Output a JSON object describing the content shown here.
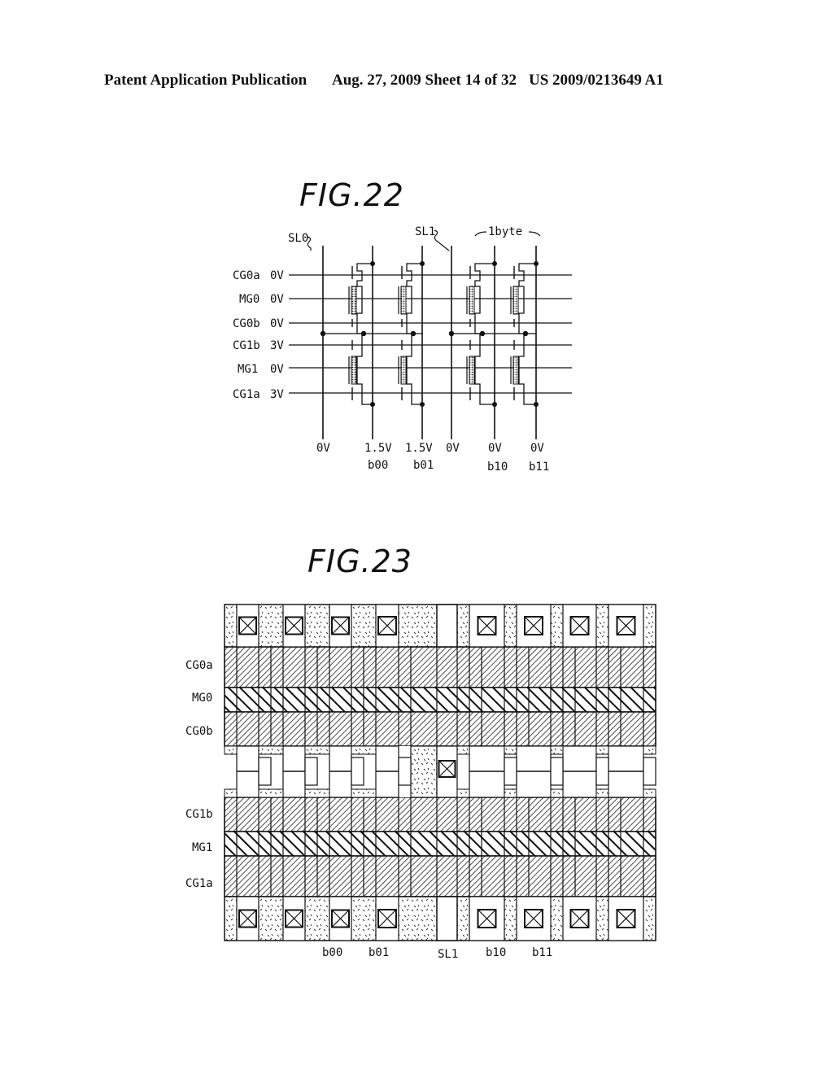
{
  "header": {
    "publication": "Patent Application Publication",
    "date_sheet": "Aug. 27, 2009  Sheet 14 of 32",
    "patent_number": "US 2009/0213649 A1"
  },
  "fig22": {
    "title": "FIG.22",
    "source_line_labels": [
      "SL0",
      "SL1"
    ],
    "group_label": "1byte",
    "rows": [
      {
        "name": "CG0a",
        "voltage": "0V"
      },
      {
        "name": "MG0",
        "voltage": "0V"
      },
      {
        "name": "CG0b",
        "voltage": "0V"
      },
      {
        "name": "CG1b",
        "voltage": "3V"
      },
      {
        "name": "MG1",
        "voltage": "0V"
      },
      {
        "name": "CG1a",
        "voltage": "3V"
      }
    ],
    "columns": [
      {
        "voltage": "0V",
        "bit": ""
      },
      {
        "voltage": "1.5V",
        "bit": "b00"
      },
      {
        "voltage": "1.5V",
        "bit": "b01"
      },
      {
        "voltage": "0V",
        "bit": ""
      },
      {
        "voltage": "0V",
        "bit": "b10"
      },
      {
        "voltage": "0V",
        "bit": "b11"
      }
    ]
  },
  "fig23": {
    "title": "FIG.23",
    "row_labels": [
      "CG0a",
      "MG0",
      "CG0b",
      "CG1b",
      "MG1",
      "CG1a"
    ],
    "bottom_labels": [
      "b00",
      "b01",
      "SL1",
      "b10",
      "b11"
    ]
  }
}
